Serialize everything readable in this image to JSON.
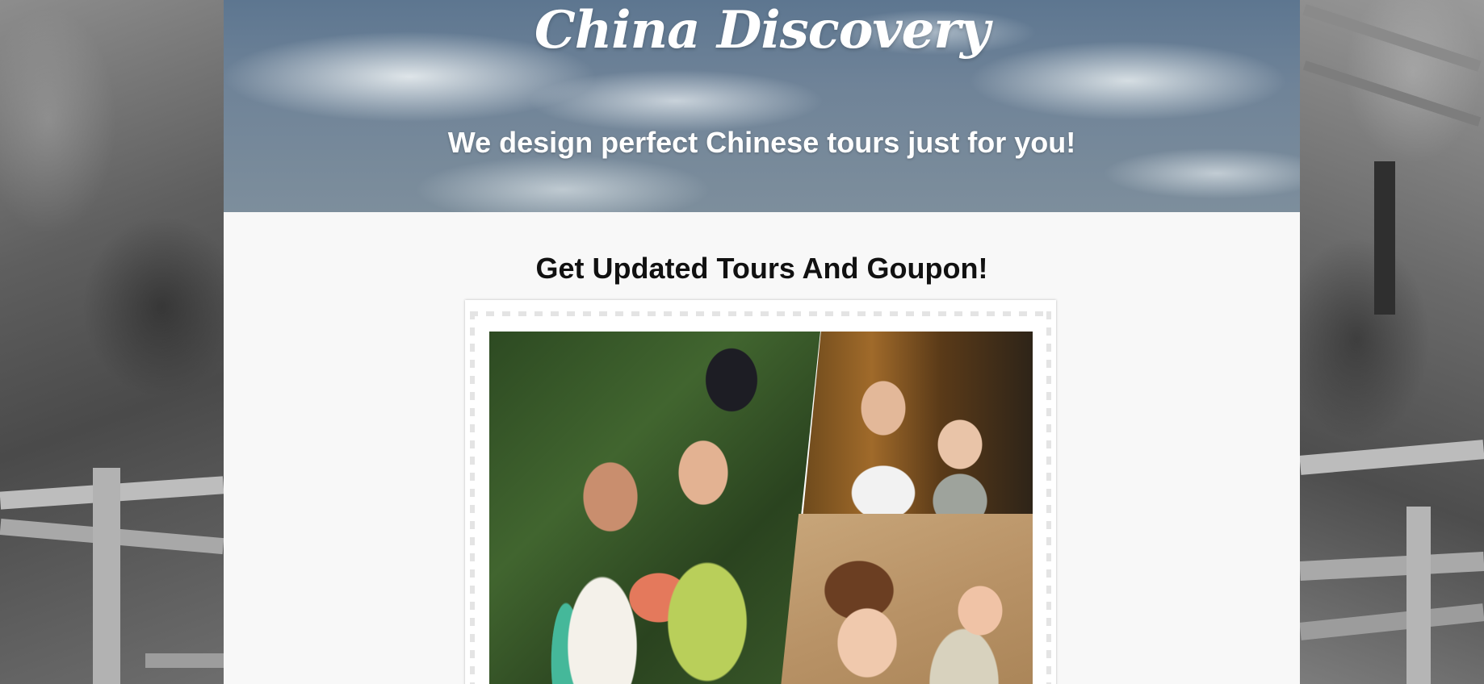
{
  "hero": {
    "brand": "China Discovery",
    "tagline": "We design perfect Chinese tours just for you!"
  },
  "newsletter": {
    "title": "Get Updated Tours And Goupon!"
  },
  "collage": {
    "photos": [
      "travel-photo-1",
      "travel-photo-2",
      "travel-photo-3"
    ]
  },
  "colors": {
    "page_background": "#f8f8f8",
    "hero_text": "#ffffff",
    "title_text": "#111111"
  }
}
